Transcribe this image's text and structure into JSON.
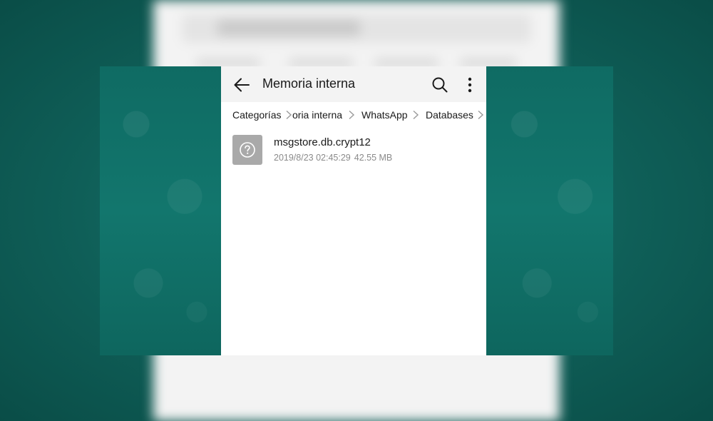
{
  "header": {
    "title": "Memoria interna",
    "back_icon": "arrow-left-icon",
    "search_icon": "search-icon",
    "more_icon": "more-vertical-icon"
  },
  "breadcrumb": {
    "items": [
      "Categorías",
      "oria interna",
      "WhatsApp",
      "Databases"
    ],
    "separator_icon": "chevron-right-icon"
  },
  "files": [
    {
      "name": "msgstore.db.crypt12",
      "date": "2019/8/23 02:45:29",
      "size": "42.55 MB",
      "icon": "unknown-file-icon"
    }
  ],
  "colors": {
    "appbar_bg": "#f3f3f3",
    "screen_bg": "#ffffff",
    "file_icon_bg": "#a9a9a9",
    "wallpaper": "#0f6b63",
    "text_primary": "#1a1a1a",
    "text_secondary": "#8a8a8a"
  }
}
